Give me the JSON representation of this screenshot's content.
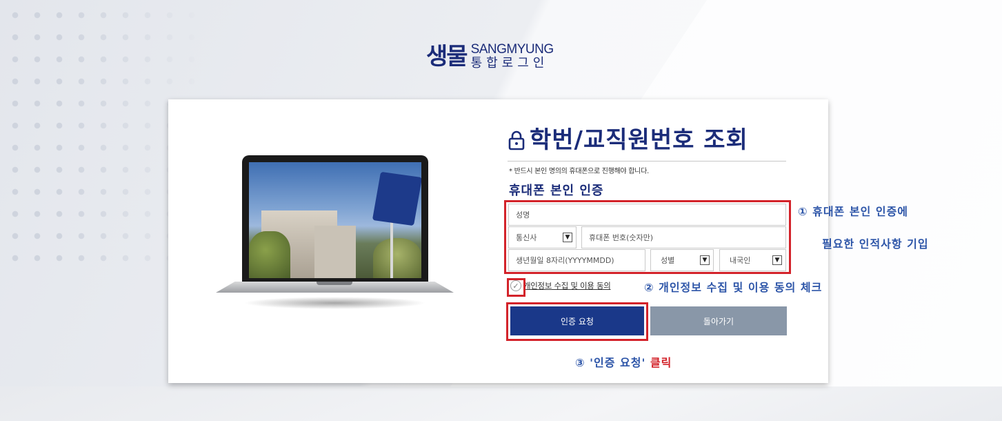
{
  "logo": {
    "mark": "생물",
    "english": "SANGMYUNG",
    "korean": "통합로그인"
  },
  "title": "학번/교직원번호 조회",
  "notice": "* 반드시 본인 명의의 휴대폰으로 진행해야 합니다.",
  "section_title": "휴대폰 본인 인증",
  "form": {
    "name_placeholder": "성명",
    "carrier_label": "통신사",
    "phone_placeholder": "휴대폰 번호(숫자만)",
    "birth_placeholder": "생년월일 8자리(YYYYMMDD)",
    "gender_label": "성별",
    "nationality_label": "내국인"
  },
  "agree_label": "개인정보 수집 및 이용 동의",
  "buttons": {
    "request": "인증 요청",
    "back": "돌아가기"
  },
  "annotations": {
    "step1_line1": "① 휴대폰 본인 인증에",
    "step1_line2": "필요한 인적사항 기입",
    "step2": "② 개인정보 수집 및 이용 동의 체크",
    "step3_prefix": "③ '인증 요청'",
    "step3_suffix": "클릭"
  },
  "icons": {
    "lock": "lock-icon",
    "check": "check-circle-icon",
    "dropdown": "chevron-down-icon"
  },
  "colors": {
    "brand_navy": "#1b2c79",
    "primary_button": "#1a3889",
    "secondary_button": "#8997a8",
    "highlight_red": "#d3232a",
    "annotation_blue": "#2d55a8"
  }
}
